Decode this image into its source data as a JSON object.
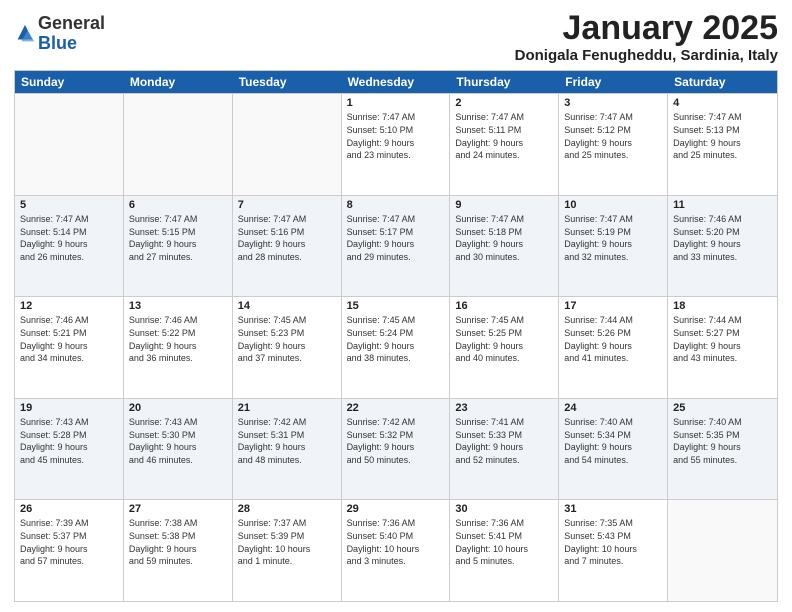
{
  "header": {
    "logo_general": "General",
    "logo_blue": "Blue",
    "month_title": "January 2025",
    "subtitle": "Donigala Fenugheddu, Sardinia, Italy"
  },
  "day_headers": [
    "Sunday",
    "Monday",
    "Tuesday",
    "Wednesday",
    "Thursday",
    "Friday",
    "Saturday"
  ],
  "weeks": [
    [
      {
        "day": "",
        "info": ""
      },
      {
        "day": "",
        "info": ""
      },
      {
        "day": "",
        "info": ""
      },
      {
        "day": "1",
        "info": "Sunrise: 7:47 AM\nSunset: 5:10 PM\nDaylight: 9 hours\nand 23 minutes."
      },
      {
        "day": "2",
        "info": "Sunrise: 7:47 AM\nSunset: 5:11 PM\nDaylight: 9 hours\nand 24 minutes."
      },
      {
        "day": "3",
        "info": "Sunrise: 7:47 AM\nSunset: 5:12 PM\nDaylight: 9 hours\nand 25 minutes."
      },
      {
        "day": "4",
        "info": "Sunrise: 7:47 AM\nSunset: 5:13 PM\nDaylight: 9 hours\nand 25 minutes."
      }
    ],
    [
      {
        "day": "5",
        "info": "Sunrise: 7:47 AM\nSunset: 5:14 PM\nDaylight: 9 hours\nand 26 minutes."
      },
      {
        "day": "6",
        "info": "Sunrise: 7:47 AM\nSunset: 5:15 PM\nDaylight: 9 hours\nand 27 minutes."
      },
      {
        "day": "7",
        "info": "Sunrise: 7:47 AM\nSunset: 5:16 PM\nDaylight: 9 hours\nand 28 minutes."
      },
      {
        "day": "8",
        "info": "Sunrise: 7:47 AM\nSunset: 5:17 PM\nDaylight: 9 hours\nand 29 minutes."
      },
      {
        "day": "9",
        "info": "Sunrise: 7:47 AM\nSunset: 5:18 PM\nDaylight: 9 hours\nand 30 minutes."
      },
      {
        "day": "10",
        "info": "Sunrise: 7:47 AM\nSunset: 5:19 PM\nDaylight: 9 hours\nand 32 minutes."
      },
      {
        "day": "11",
        "info": "Sunrise: 7:46 AM\nSunset: 5:20 PM\nDaylight: 9 hours\nand 33 minutes."
      }
    ],
    [
      {
        "day": "12",
        "info": "Sunrise: 7:46 AM\nSunset: 5:21 PM\nDaylight: 9 hours\nand 34 minutes."
      },
      {
        "day": "13",
        "info": "Sunrise: 7:46 AM\nSunset: 5:22 PM\nDaylight: 9 hours\nand 36 minutes."
      },
      {
        "day": "14",
        "info": "Sunrise: 7:45 AM\nSunset: 5:23 PM\nDaylight: 9 hours\nand 37 minutes."
      },
      {
        "day": "15",
        "info": "Sunrise: 7:45 AM\nSunset: 5:24 PM\nDaylight: 9 hours\nand 38 minutes."
      },
      {
        "day": "16",
        "info": "Sunrise: 7:45 AM\nSunset: 5:25 PM\nDaylight: 9 hours\nand 40 minutes."
      },
      {
        "day": "17",
        "info": "Sunrise: 7:44 AM\nSunset: 5:26 PM\nDaylight: 9 hours\nand 41 minutes."
      },
      {
        "day": "18",
        "info": "Sunrise: 7:44 AM\nSunset: 5:27 PM\nDaylight: 9 hours\nand 43 minutes."
      }
    ],
    [
      {
        "day": "19",
        "info": "Sunrise: 7:43 AM\nSunset: 5:28 PM\nDaylight: 9 hours\nand 45 minutes."
      },
      {
        "day": "20",
        "info": "Sunrise: 7:43 AM\nSunset: 5:30 PM\nDaylight: 9 hours\nand 46 minutes."
      },
      {
        "day": "21",
        "info": "Sunrise: 7:42 AM\nSunset: 5:31 PM\nDaylight: 9 hours\nand 48 minutes."
      },
      {
        "day": "22",
        "info": "Sunrise: 7:42 AM\nSunset: 5:32 PM\nDaylight: 9 hours\nand 50 minutes."
      },
      {
        "day": "23",
        "info": "Sunrise: 7:41 AM\nSunset: 5:33 PM\nDaylight: 9 hours\nand 52 minutes."
      },
      {
        "day": "24",
        "info": "Sunrise: 7:40 AM\nSunset: 5:34 PM\nDaylight: 9 hours\nand 54 minutes."
      },
      {
        "day": "25",
        "info": "Sunrise: 7:40 AM\nSunset: 5:35 PM\nDaylight: 9 hours\nand 55 minutes."
      }
    ],
    [
      {
        "day": "26",
        "info": "Sunrise: 7:39 AM\nSunset: 5:37 PM\nDaylight: 9 hours\nand 57 minutes."
      },
      {
        "day": "27",
        "info": "Sunrise: 7:38 AM\nSunset: 5:38 PM\nDaylight: 9 hours\nand 59 minutes."
      },
      {
        "day": "28",
        "info": "Sunrise: 7:37 AM\nSunset: 5:39 PM\nDaylight: 10 hours\nand 1 minute."
      },
      {
        "day": "29",
        "info": "Sunrise: 7:36 AM\nSunset: 5:40 PM\nDaylight: 10 hours\nand 3 minutes."
      },
      {
        "day": "30",
        "info": "Sunrise: 7:36 AM\nSunset: 5:41 PM\nDaylight: 10 hours\nand 5 minutes."
      },
      {
        "day": "31",
        "info": "Sunrise: 7:35 AM\nSunset: 5:43 PM\nDaylight: 10 hours\nand 7 minutes."
      },
      {
        "day": "",
        "info": ""
      }
    ]
  ]
}
